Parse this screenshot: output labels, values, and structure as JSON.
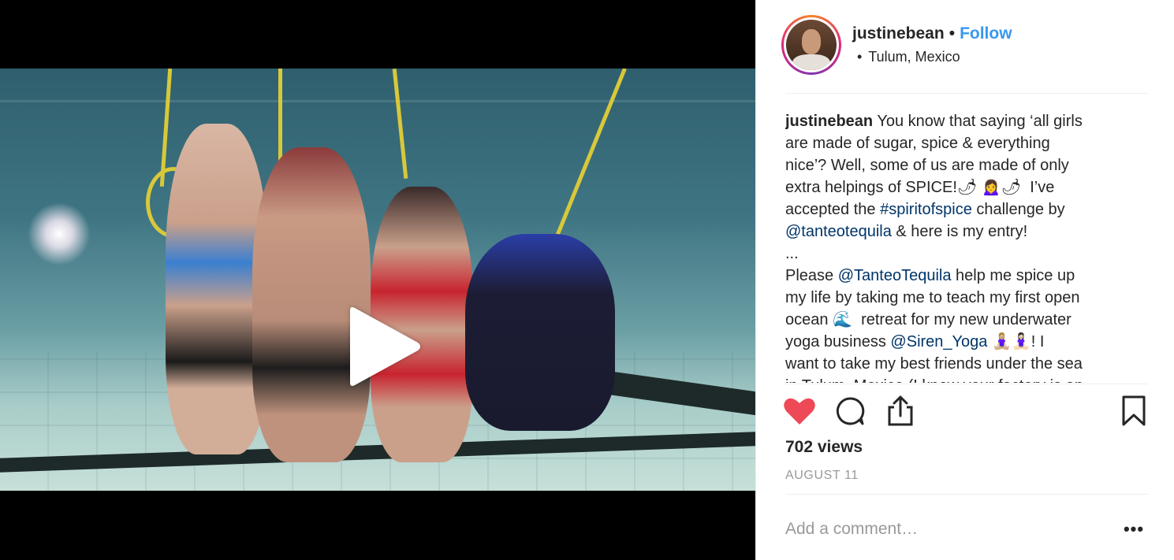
{
  "post": {
    "author": {
      "username": "justinebean",
      "follow_label": "Follow",
      "separator": "•",
      "location": "Tulum, Mexico",
      "location_bullet": "•"
    },
    "caption": {
      "username": "justinebean",
      "line1": " You know that saying ‘all girls",
      "line2": "are made of sugar, spice & everything",
      "line3": "nice’? Well, some of us are made of only",
      "line4": "extra helpings of SPICE!🌶 🙍‍♀️🌶  I’ve",
      "line5_pre": "accepted the ",
      "hashtag": "#spiritofspice",
      "line5_post": " challenge by",
      "mention1": "@tanteotequila",
      "line6_post": " & here is my entry!",
      "line7": "...",
      "line8_pre": "Please ",
      "mention2": "@TanteoTequila",
      "line8_post": " help me spice up",
      "line9": "my life by taking me to teach my first open",
      "line10": "ocean 🌊  retreat for my new underwater",
      "line11_pre": "yoga business ",
      "mention3": "@Siren_Yoga",
      "line11_post": " 🧘🏼‍♀️🧘🏻‍♀️! I",
      "line12": "want to take my best friends under the sea",
      "line13": "in Tulum, Mexico (I know your factory is an"
    },
    "stats": {
      "views": "702 views",
      "date": "AUGUST 11"
    },
    "comment": {
      "placeholder": "Add a comment…",
      "more_label": "•••"
    }
  },
  "icons": {
    "play": "play-icon",
    "like": "heart-filled-icon",
    "comment": "comment-bubble-icon",
    "share": "share-icon",
    "save": "bookmark-icon"
  },
  "colors": {
    "follow": "#3897f0",
    "link": "#003569",
    "like": "#ed4956",
    "muted": "#999999"
  }
}
